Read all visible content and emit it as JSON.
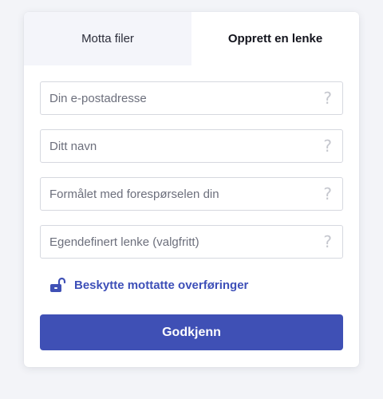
{
  "tabs": [
    {
      "label": "Motta filer",
      "active": false
    },
    {
      "label": "Opprett en lenke",
      "active": true
    }
  ],
  "fields": [
    {
      "placeholder": "Din e-postadresse",
      "value": "",
      "help_icon": "question-mark-icon"
    },
    {
      "placeholder": "Ditt navn",
      "value": "",
      "help_icon": "question-mark-icon"
    },
    {
      "placeholder": "Formålet med forespørselen din",
      "value": "",
      "help_icon": "question-mark-icon"
    },
    {
      "placeholder": "Egendefinert lenke (valgfritt)",
      "value": "",
      "help_icon": "question-mark-icon"
    }
  ],
  "help_glyph": "?",
  "protect": {
    "label": "Beskytte mottatte overføringer",
    "icon": "unlocked-padlock-icon"
  },
  "submit_label": "Godkjenn",
  "colors": {
    "accent": "#3f50b5",
    "link": "#3d4fb8",
    "inactive_tab_bg": "#f4f5fa",
    "page_bg": "#f3f4f8"
  }
}
